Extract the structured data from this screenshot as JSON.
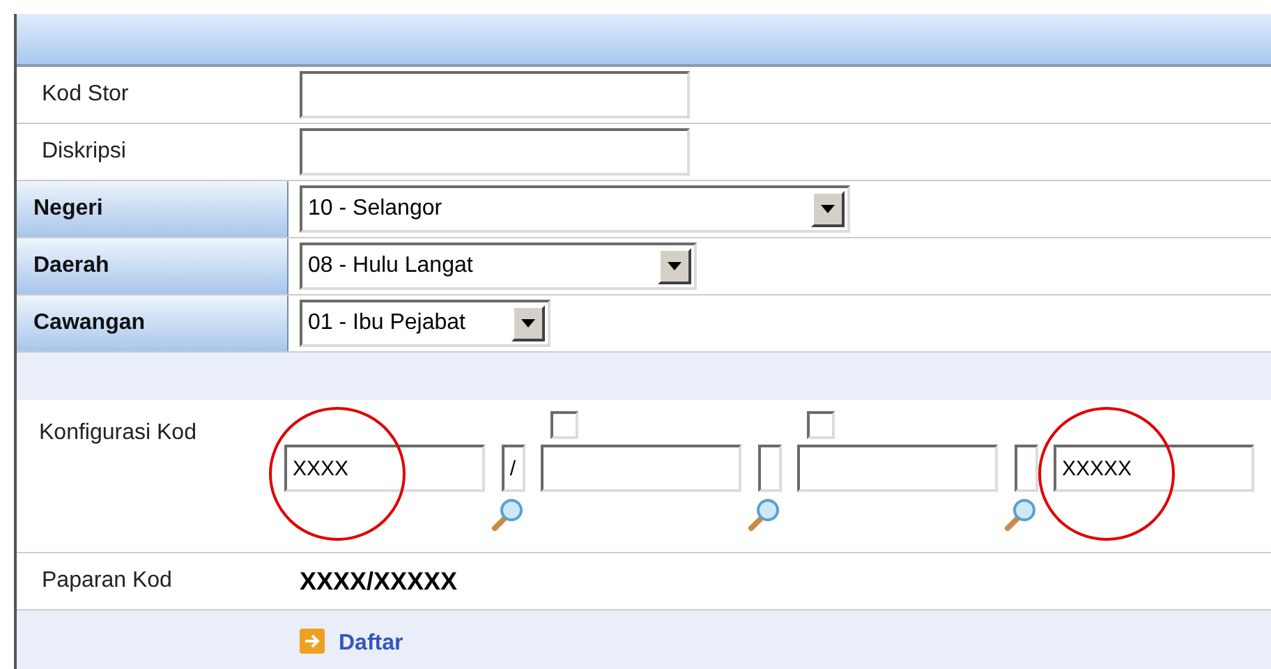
{
  "form": {
    "rows": [
      {
        "label": "Kod Stor",
        "kind": "input",
        "header": false
      },
      {
        "label": "Diskripsi",
        "kind": "input",
        "header": false
      },
      {
        "label": "Negeri",
        "kind": "select",
        "header": true,
        "value": "10 - Selangor"
      },
      {
        "label": "Daerah",
        "kind": "select",
        "header": true,
        "value": "08 - Hulu Langat"
      },
      {
        "label": "Cawangan",
        "kind": "select",
        "header": true,
        "value": "01 - Ibu Pejabat"
      }
    ],
    "konfigurasi": {
      "label": "Konfigurasi Kod",
      "parts": [
        {
          "kind": "field",
          "value": "XXXX",
          "circled": true
        },
        {
          "kind": "separator",
          "value": "/"
        },
        {
          "kind": "field",
          "checked": false,
          "circled": false
        },
        {
          "kind": "separator"
        },
        {
          "kind": "field",
          "checked": false,
          "circled": false
        },
        {
          "kind": "separator"
        },
        {
          "kind": "field",
          "value": "XXXXX",
          "circled": true
        }
      ]
    },
    "paparan": {
      "label": "Paparan Kod",
      "value": "XXXX/XXXXX"
    },
    "submit": {
      "label": "Daftar"
    }
  }
}
